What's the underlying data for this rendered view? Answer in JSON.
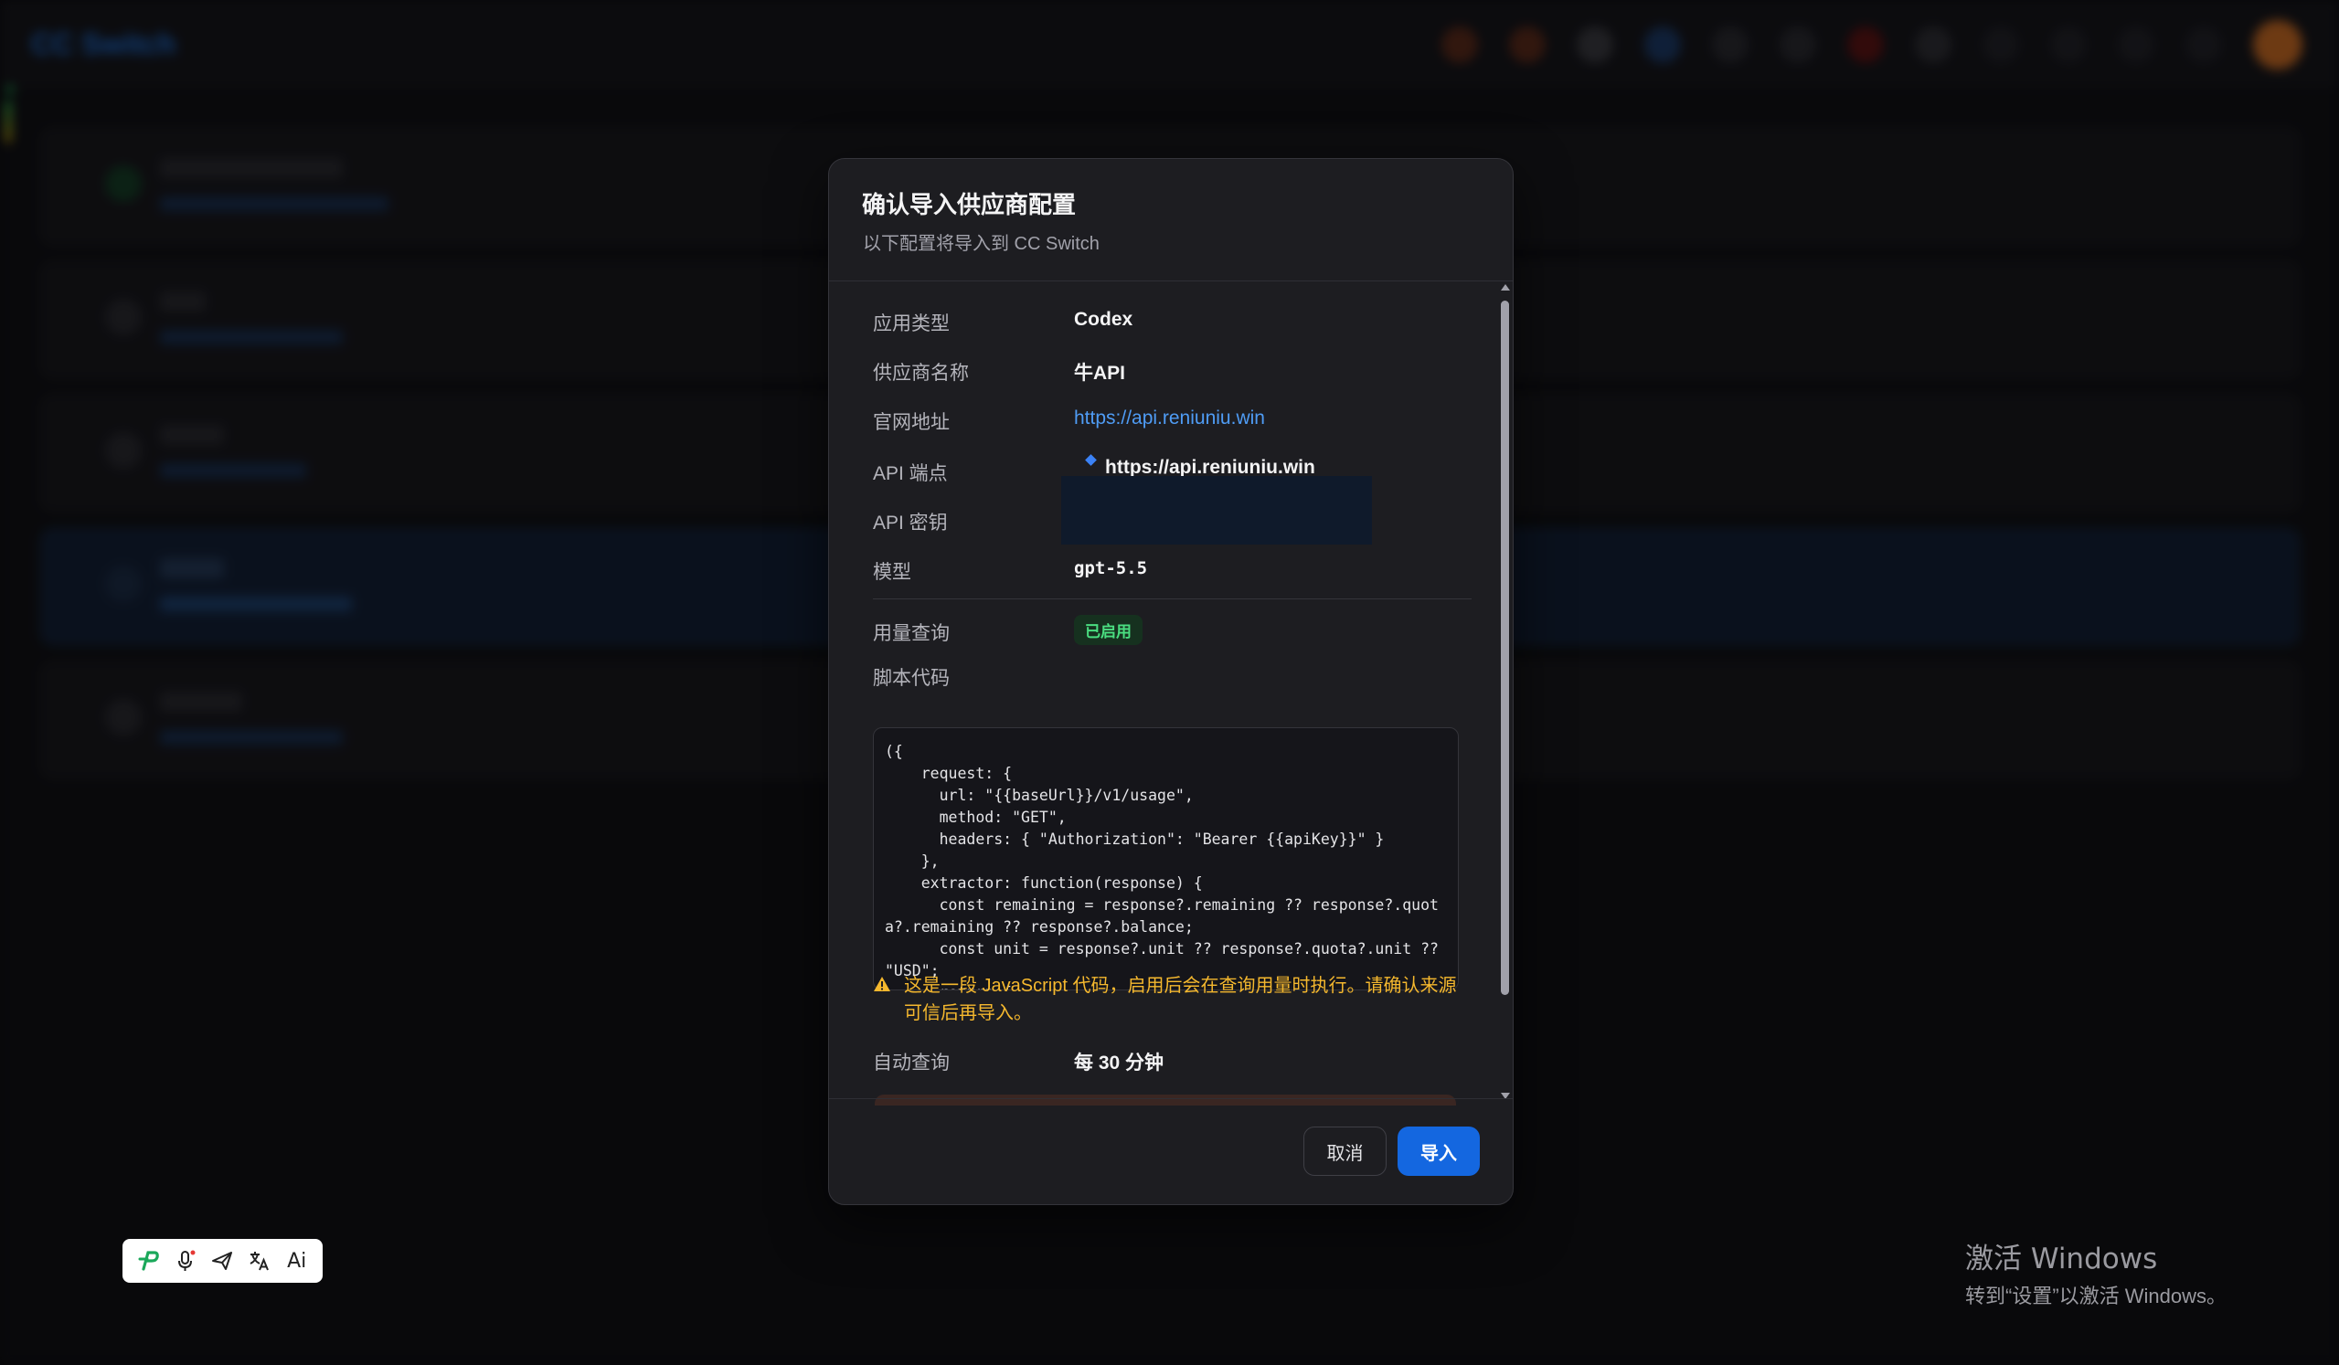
{
  "background": {
    "brand": "CC Switch"
  },
  "dialog": {
    "title": "确认导入供应商配置",
    "subtitle": "以下配置将导入到 CC Switch",
    "fields": {
      "app_type_label": "应用类型",
      "app_type_value": "Codex",
      "provider_name_label": "供应商名称",
      "provider_name_value": "牛API",
      "website_label": "官网地址",
      "website_value": "https://api.reniuniu.win",
      "endpoint_label": "API 端点",
      "endpoint_value": "https://api.reniuniu.win",
      "api_key_label": "API 密钥",
      "model_label": "模型",
      "model_value": "gpt-5.5",
      "usage_label": "用量查询",
      "usage_badge": "已启用",
      "script_label": "脚本代码",
      "script_code": "({\n    request: {\n      url: \"{{baseUrl}}/v1/usage\",\n      method: \"GET\",\n      headers: { \"Authorization\": \"Bearer {{apiKey}}\" }\n    },\n    extractor: function(response) {\n      const remaining = response?.remaining ?? response?.quota?.remaining ?? response?.balance;\n      const unit = response?.unit ?? response?.quota?.unit ?? \"USD\";\n      return {",
      "warning_text": "这是一段 JavaScript 代码，启用后会在查询用量时执行。请确认来源可信后再导入。",
      "auto_query_label": "自动查询",
      "auto_query_value": "每 30 分钟"
    },
    "buttons": {
      "cancel": "取消",
      "import": "导入"
    }
  },
  "watermark": {
    "title": "激活 Windows",
    "subtitle": "转到“设置”以激活 Windows。"
  },
  "floating_toolbar": {
    "ai_label": "Ai"
  },
  "colors": {
    "accent": "#1467e0",
    "link": "#4f9cf5",
    "warning": "#f5b82e",
    "badge": "#4ade80"
  }
}
